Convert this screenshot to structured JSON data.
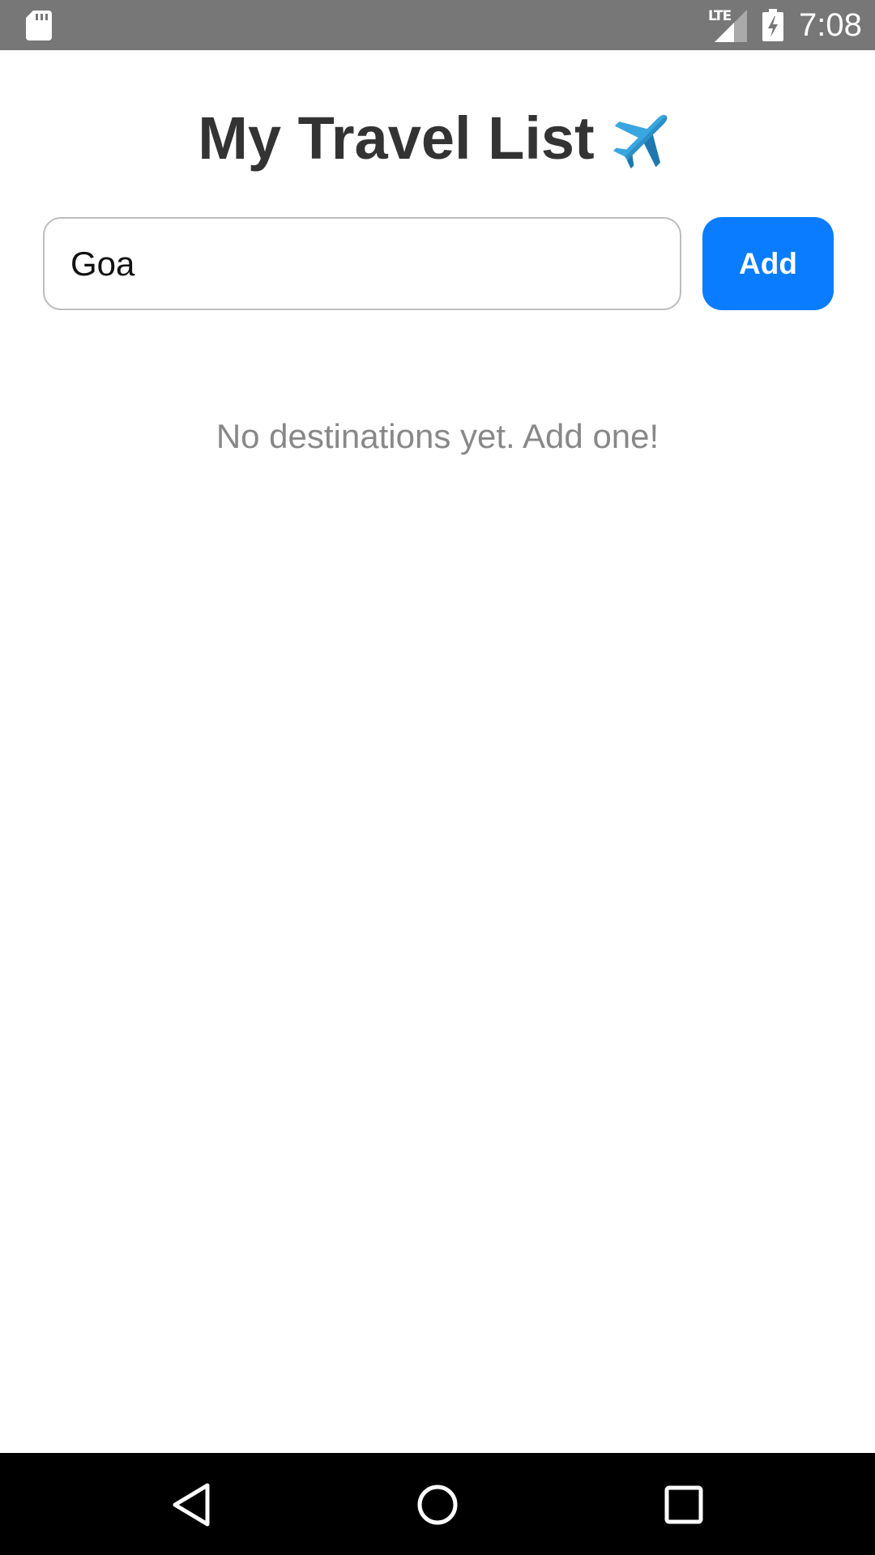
{
  "status_bar": {
    "network_label": "LTE",
    "time": "7:08",
    "icons": [
      "sd-card-icon",
      "signal-icon",
      "battery-charging-icon"
    ]
  },
  "header": {
    "title": "My Travel List",
    "icon": "airplane-icon"
  },
  "form": {
    "destination_value": "Goa",
    "add_label": "Add"
  },
  "list": {
    "empty_text": "No destinations yet. Add one!"
  },
  "nav_bar": {
    "icons": [
      "back-icon",
      "home-icon",
      "recents-icon"
    ]
  },
  "colors": {
    "status_bar_bg": "#777777",
    "accent": "#0a7cff",
    "title_text": "#333333",
    "muted_text": "#888888",
    "nav_bar_bg": "#000000"
  }
}
